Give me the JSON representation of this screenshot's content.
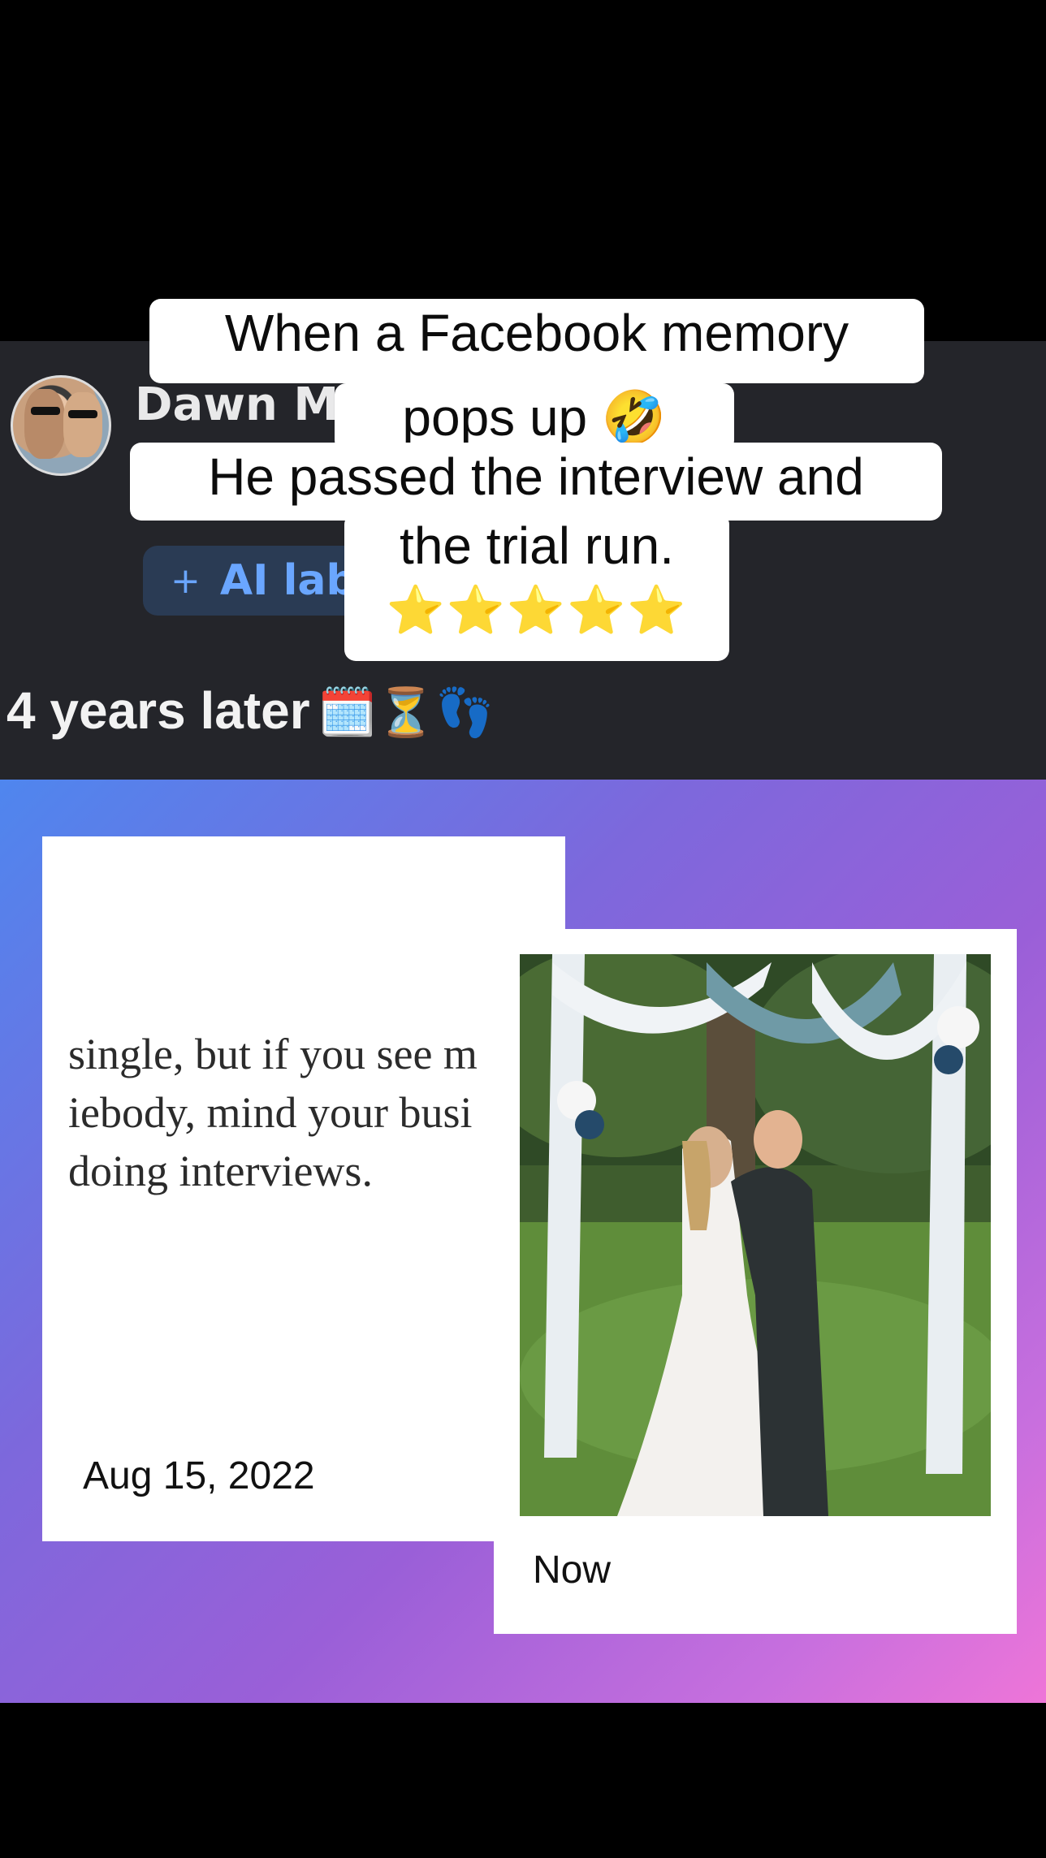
{
  "post": {
    "username": "Dawn Ma",
    "ai_label": "AI lab",
    "ai_label_plus": "+"
  },
  "overlay_caption": {
    "line1": "When a Facebook memory",
    "line2": "pops up 🤣",
    "line3": "He passed the interview and",
    "line4": "the trial run.",
    "stars": "⭐⭐⭐⭐⭐"
  },
  "subheading": {
    "text": "4 years later",
    "emoji": "🗓️⏳👣"
  },
  "memory_card": {
    "text_lines": [
      "single, but if you see m",
      "iebody, mind your busi",
      "doing interviews."
    ],
    "date": "Aug 15, 2022"
  },
  "now_card": {
    "label": "Now",
    "photo": "wedding-kiss-photo"
  }
}
